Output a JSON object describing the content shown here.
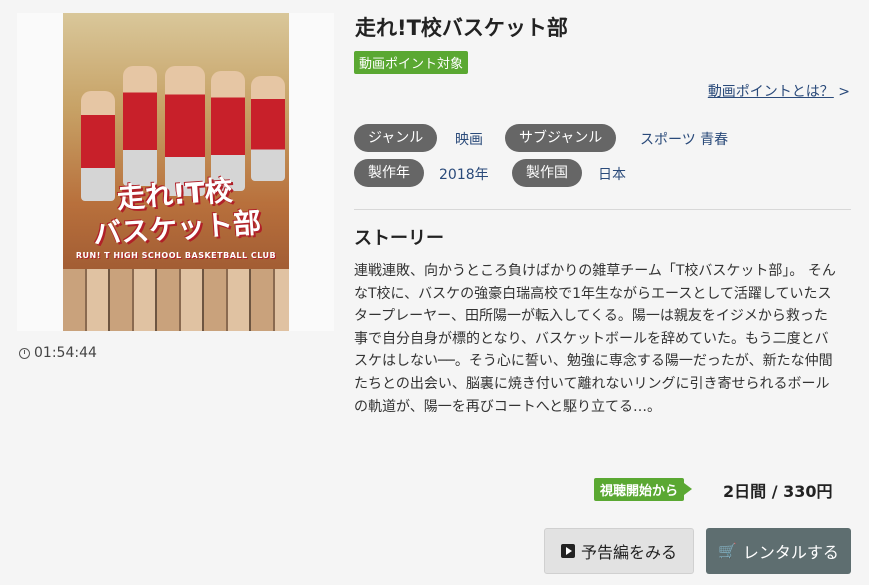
{
  "movie": {
    "title": "走れ!T校バスケット部",
    "point_badge": "動画ポイント対象",
    "point_link": "動画ポイントとは？",
    "point_link_arrow": ">",
    "duration": "01:54:44",
    "poster": {
      "title_line1": "走れ!T校",
      "title_line2": "バスケット部",
      "subtitle": "RUN! T HIGH SCHOOL BASKETBALL CLUB"
    }
  },
  "meta": {
    "genre_label": "ジャンル",
    "genre_value": "映画",
    "subgenre_label": "サブジャンル",
    "subgenre_value": "スポーツ 青春",
    "year_label": "製作年",
    "year_value": "2018年",
    "country_label": "製作国",
    "country_value": "日本"
  },
  "story": {
    "heading": "ストーリー",
    "text": "連戦連敗、向かうところ負けばかりの雑草チーム「T校バスケット部」。 そんなT校に、バスケの強豪白瑞高校で1年生ながらエースとして活躍していたスタープレーヤー、田所陽一が転入してくる。陽一は親友をイジメから救った事で自分自身が標的となり、バスケットボールを辞めていた。もう二度とバスケはしない──。そう心に誓い、勉強に専念する陽一だったが、新たな仲間たちとの出会い、脳裏に焼き付いて離れないリングに引き寄せられるボールの軌道が、陽一を再びコートへと駆り立てる…。"
  },
  "rental": {
    "badge": "視聴開始から",
    "price": "2日間 / 330円",
    "trailer_button": "予告編をみる",
    "rent_button": "レンタルする"
  },
  "colors": {
    "green": "#5aa832",
    "chip": "#666666",
    "link": "#2a4a7a",
    "rent_button": "#5e6e70"
  },
  "icons": [
    "clock-icon",
    "play-icon",
    "cart-icon"
  ]
}
